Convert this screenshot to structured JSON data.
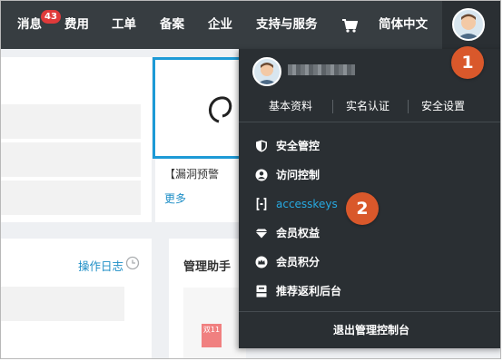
{
  "nav": {
    "messages": "消息",
    "message_count": "43",
    "billing": "费用",
    "tickets": "工单",
    "icp": "备案",
    "enterprise": "企业",
    "support": "支持与服务",
    "cart_icon": "cart-icon",
    "language": "简体中文"
  },
  "background": {
    "vuln_text": "【漏洞预警",
    "more": "更多",
    "op_log": "操作日志",
    "helper": "管理助手",
    "promo": "双11"
  },
  "dropdown": {
    "tabs": [
      "基本资料",
      "实名认证",
      "安全设置"
    ],
    "items": [
      {
        "label": "安全管控",
        "icon": "shield-icon"
      },
      {
        "label": "访问控制",
        "icon": "user-circle-icon"
      },
      {
        "label": "accesskeys",
        "icon": "key-bracket-icon"
      },
      {
        "label": "会员权益",
        "icon": "diamond-icon"
      },
      {
        "label": "会员积分",
        "icon": "crown-icon"
      },
      {
        "label": "推荐返利后台",
        "icon": "document-icon"
      }
    ],
    "logout": "退出管理控制台"
  },
  "callouts": [
    "1",
    "2"
  ],
  "colors": {
    "topbar": "#373d41",
    "dropdown": "#2a2f33",
    "accent": "#27a9e1",
    "callout": "#d9582b",
    "badge": "#e03a3a"
  }
}
